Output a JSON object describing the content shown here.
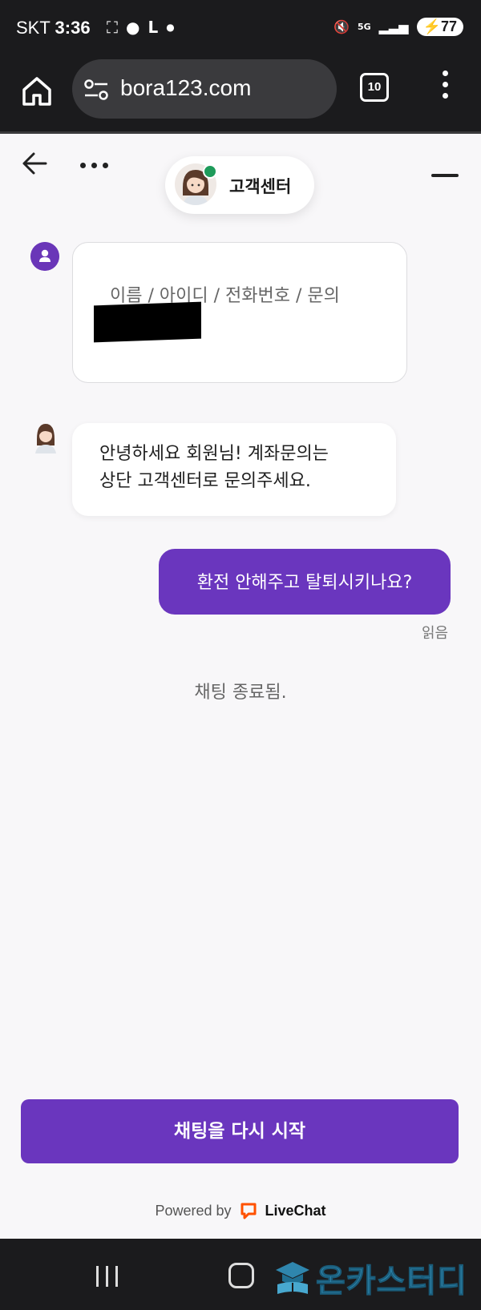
{
  "status_bar": {
    "carrier": "SKT",
    "time": "3:36",
    "network": "5G",
    "battery": "77"
  },
  "browser": {
    "url": "bora123.com",
    "tab_count": "10"
  },
  "chat_header": {
    "agent_name": "고객센터"
  },
  "messages": {
    "form_prompt": "이름 / 아이디 / 전화번호 / 문의",
    "agent_line1": "안녕하세요 회원님! 계좌문의는",
    "agent_line2": "상단 고객센터로 문의주세요.",
    "user_message": "환전 안해주고 탈퇴시키나요?",
    "read_status": "읽음",
    "chat_ended": "채팅 종료됨."
  },
  "footer": {
    "restart_label": "채팅을 다시 시작",
    "powered_by": "Powered by",
    "brand": "LiveChat"
  },
  "watermark": {
    "text": "온카스터디"
  },
  "colors": {
    "accent": "#6a36be",
    "online": "#1e9b5a",
    "livechat_orange": "#ff5100"
  }
}
